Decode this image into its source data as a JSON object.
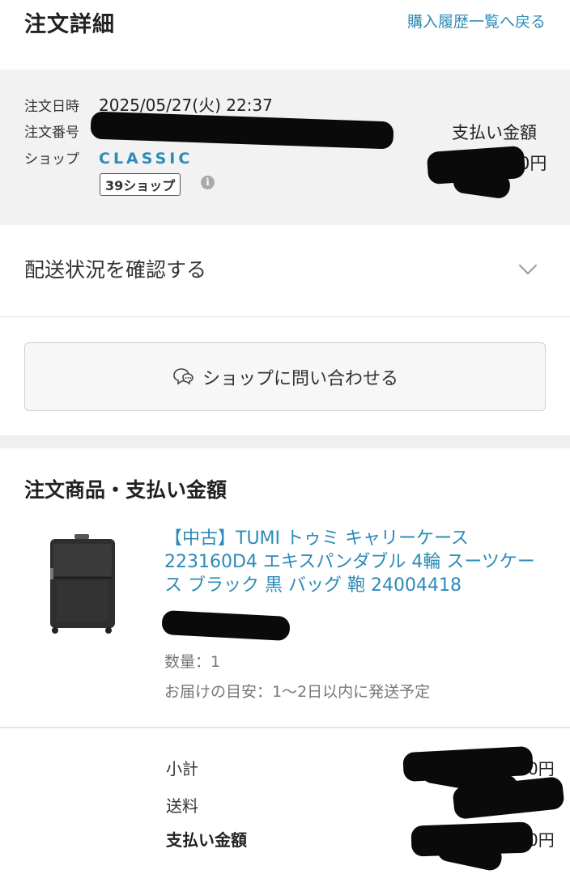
{
  "header": {
    "title": "注文詳細",
    "back_link": "購入履歴一覧へ戻る"
  },
  "order": {
    "date_label": "注文日時",
    "date_value": "2025/05/27(火) 22:37",
    "number_label": "注文番号",
    "shop_label": "ショップ",
    "shop_name": "CLASSIC",
    "shop_badge": "39ショップ",
    "info_icon": "i",
    "payment_label": "支払い金額",
    "payment_suffix": "0円"
  },
  "shipping": {
    "label": "配送状況を確認する"
  },
  "contact": {
    "label": "ショップに問い合わせる"
  },
  "items_section": {
    "title": "注文商品・支払い金額"
  },
  "product": {
    "name": "【中古】TUMI トゥミ キャリーケース 223160D4 エキスパンダブル 4輪 スーツケース ブラック 黒 バッグ 鞄 24004418",
    "quantity": "数量：1",
    "delivery": "お届けの目安：1〜2日以内に発送予定"
  },
  "summary": {
    "subtotal_label": "小計",
    "subtotal_suffix": "0円",
    "shipping_label": "送料",
    "total_label": "支払い金額",
    "total_suffix": "0円"
  },
  "colors": {
    "link": "#2c8bb8",
    "panel": "#f2f2f2"
  }
}
